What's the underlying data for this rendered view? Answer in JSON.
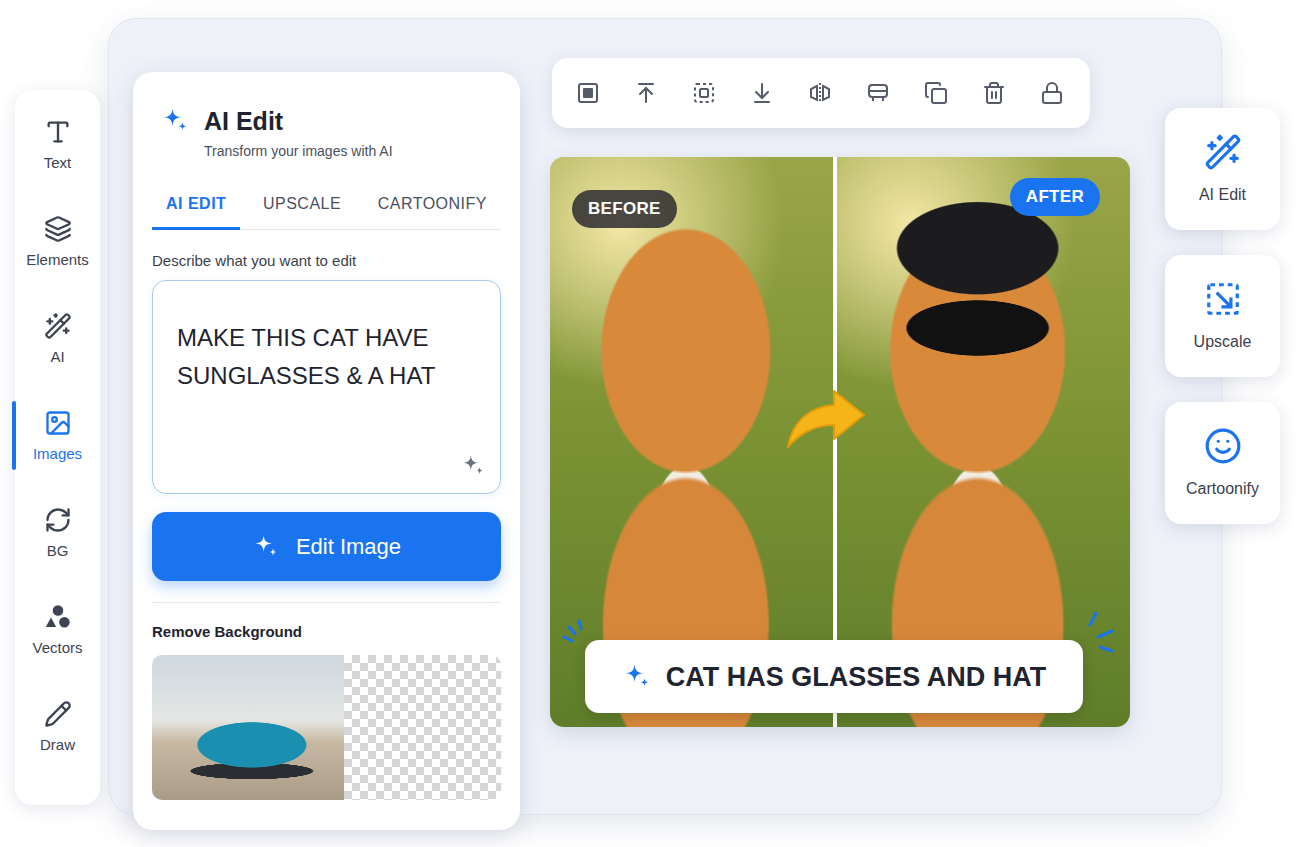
{
  "tool_rail": {
    "items": [
      {
        "label": "Text",
        "selected": false
      },
      {
        "label": "Elements",
        "selected": false
      },
      {
        "label": "AI",
        "selected": false
      },
      {
        "label": "Images",
        "selected": true
      },
      {
        "label": "BG",
        "selected": false
      },
      {
        "label": "Vectors",
        "selected": false
      },
      {
        "label": "Draw",
        "selected": false
      }
    ]
  },
  "panel": {
    "title": "AI Edit",
    "subtitle": "Transform your images with AI",
    "tabs": [
      {
        "label": "AI EDIT",
        "selected": true
      },
      {
        "label": "UPSCALE",
        "selected": false
      },
      {
        "label": "CARTOONIFY",
        "selected": false
      }
    ],
    "prompt_label": "Describe what you want to edit",
    "prompt_value": "MAKE THIS CAT HAVE SUNGLASSES & A HAT",
    "button": "Edit Image",
    "remove_background": {
      "title": "Remove Background"
    }
  },
  "canvas": {
    "before_label": "BEFORE",
    "after_label": "AFTER",
    "caption": "CAT HAS GLASSES AND HAT"
  },
  "quick_actions": [
    {
      "label": "AI Edit"
    },
    {
      "label": "Upscale"
    },
    {
      "label": "Cartoonify"
    }
  ]
}
